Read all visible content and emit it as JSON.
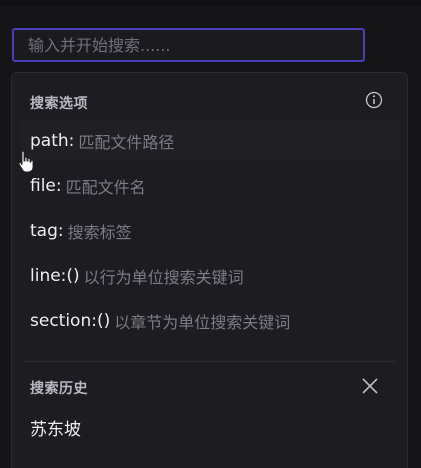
{
  "search": {
    "placeholder": "输入并开始搜索......"
  },
  "options_panel": {
    "title": "搜索选项",
    "info_icon": "info-icon",
    "items": [
      {
        "key": "path:",
        "description": "匹配文件路径"
      },
      {
        "key": "file:",
        "description": "匹配文件名"
      },
      {
        "key": "tag:",
        "description": "搜索标签"
      },
      {
        "key": "line:()",
        "description": "以行为单位搜索关键词"
      },
      {
        "key": "section:()",
        "description": "以章节为单位搜索关键词"
      }
    ]
  },
  "history_panel": {
    "title": "搜索历史",
    "clear_icon": "close-icon",
    "items": [
      {
        "label": "苏东坡"
      }
    ]
  },
  "colors": {
    "accent_border": "#4a3fb8",
    "panel_bg": "#1d1d21",
    "page_bg": "#151517"
  }
}
